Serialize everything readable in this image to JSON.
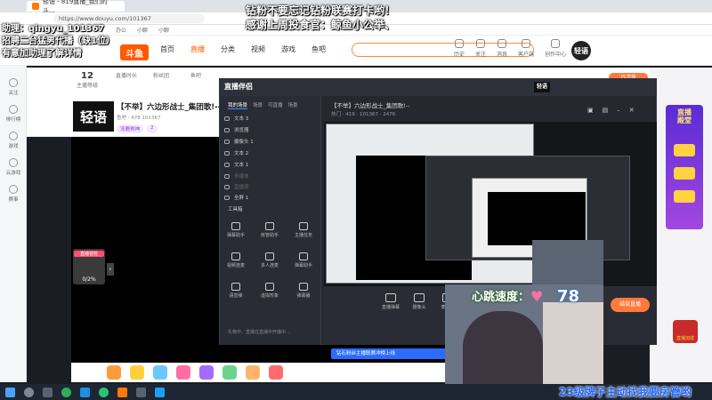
{
  "browser": {
    "tab_title": "轻语 - 819直播_我们的斗...",
    "url": "https://www.douyu.com/101367",
    "bookmarks": [
      "办公",
      "小聊",
      "小聊"
    ]
  },
  "site": {
    "logo": "斗鱼",
    "nav": [
      "首页",
      "直播",
      "分类",
      "视频",
      "游戏",
      "鱼吧"
    ],
    "active_nav": "直播",
    "header_icons": [
      "历史",
      "关注",
      "消息",
      "客户端",
      "创作中心"
    ],
    "avatar_text": "轻语"
  },
  "sidebar": [
    {
      "label": "关注"
    },
    {
      "label": "排行榜"
    },
    {
      "label": "游戏"
    },
    {
      "label": "云游戏"
    },
    {
      "label": "赛事"
    }
  ],
  "stats": [
    {
      "value": "12",
      "label": "主播等级"
    },
    {
      "value": "",
      "label": "直播时长"
    },
    {
      "value": "",
      "label": "粉丝团"
    },
    {
      "value": "",
      "label": "鱼吧"
    }
  ],
  "streamer": {
    "thumb_text": "轻语",
    "title": "【不举】六边形战士_集团歌!--",
    "meta": "鱼吧 · 478 101367",
    "tags": [
      "流鹿男神",
      "2"
    ]
  },
  "gift": {
    "tag": "直播冒险",
    "value": "0/2%"
  },
  "overlay": {
    "left_line1": "助理：qingyu_101367",
    "left_line2": "招聘二台猛男代播（缺1位）",
    "left_line3": "有意加助理了解详情",
    "top_line1": "钻粉不要忘记钻粉联赛打卡哟！",
    "top_line2": "感谢上周投食官：鲸鱼小公举、",
    "bottom_line": "23级牌子主动找我要房管哟"
  },
  "companion": {
    "app_name": "直播伴侣",
    "avatar_text": "轻语",
    "title": "【不举】六边形战士_集团歌!--",
    "subtitle": "热门 · 419 · 101367 · 2476",
    "tabs": [
      "我的场景",
      "场景",
      "可直播",
      "场景"
    ],
    "layers": [
      {
        "name": "文本 3",
        "dim": false
      },
      {
        "name": "浏览器",
        "dim": false
      },
      {
        "name": "摄像头 1",
        "dim": false
      },
      {
        "name": "文本 2",
        "dim": false
      },
      {
        "name": "文本 1",
        "dim": false
      },
      {
        "name": "多媒体",
        "dim": true
      },
      {
        "name": "直播源",
        "dim": true
      },
      {
        "name": "全屏 1",
        "dim": false
      }
    ],
    "tools_title": "工具箱",
    "tools": [
      "弹幕助手",
      "房管助手",
      "主播任务",
      "视频连麦",
      "多人连麦",
      "弹幕助手",
      "语音弹",
      "虚拟形象",
      "弹幕播"
    ],
    "status": "礼物中、直播在直播中开播中...",
    "bottom_tools": [
      "直播弹幕",
      "摄像头",
      "麦克风",
      "设置"
    ],
    "stop_label": "结束直播",
    "banner": "钻石粉丝主播联赛冲榜上线"
  },
  "webcam": {
    "label": "心跳速度：",
    "bpm": "78"
  },
  "right_panel": {
    "badge": "PC直播",
    "card_title_1": "直播",
    "card_title_2": "殿堂",
    "red_label": "直播加成"
  }
}
